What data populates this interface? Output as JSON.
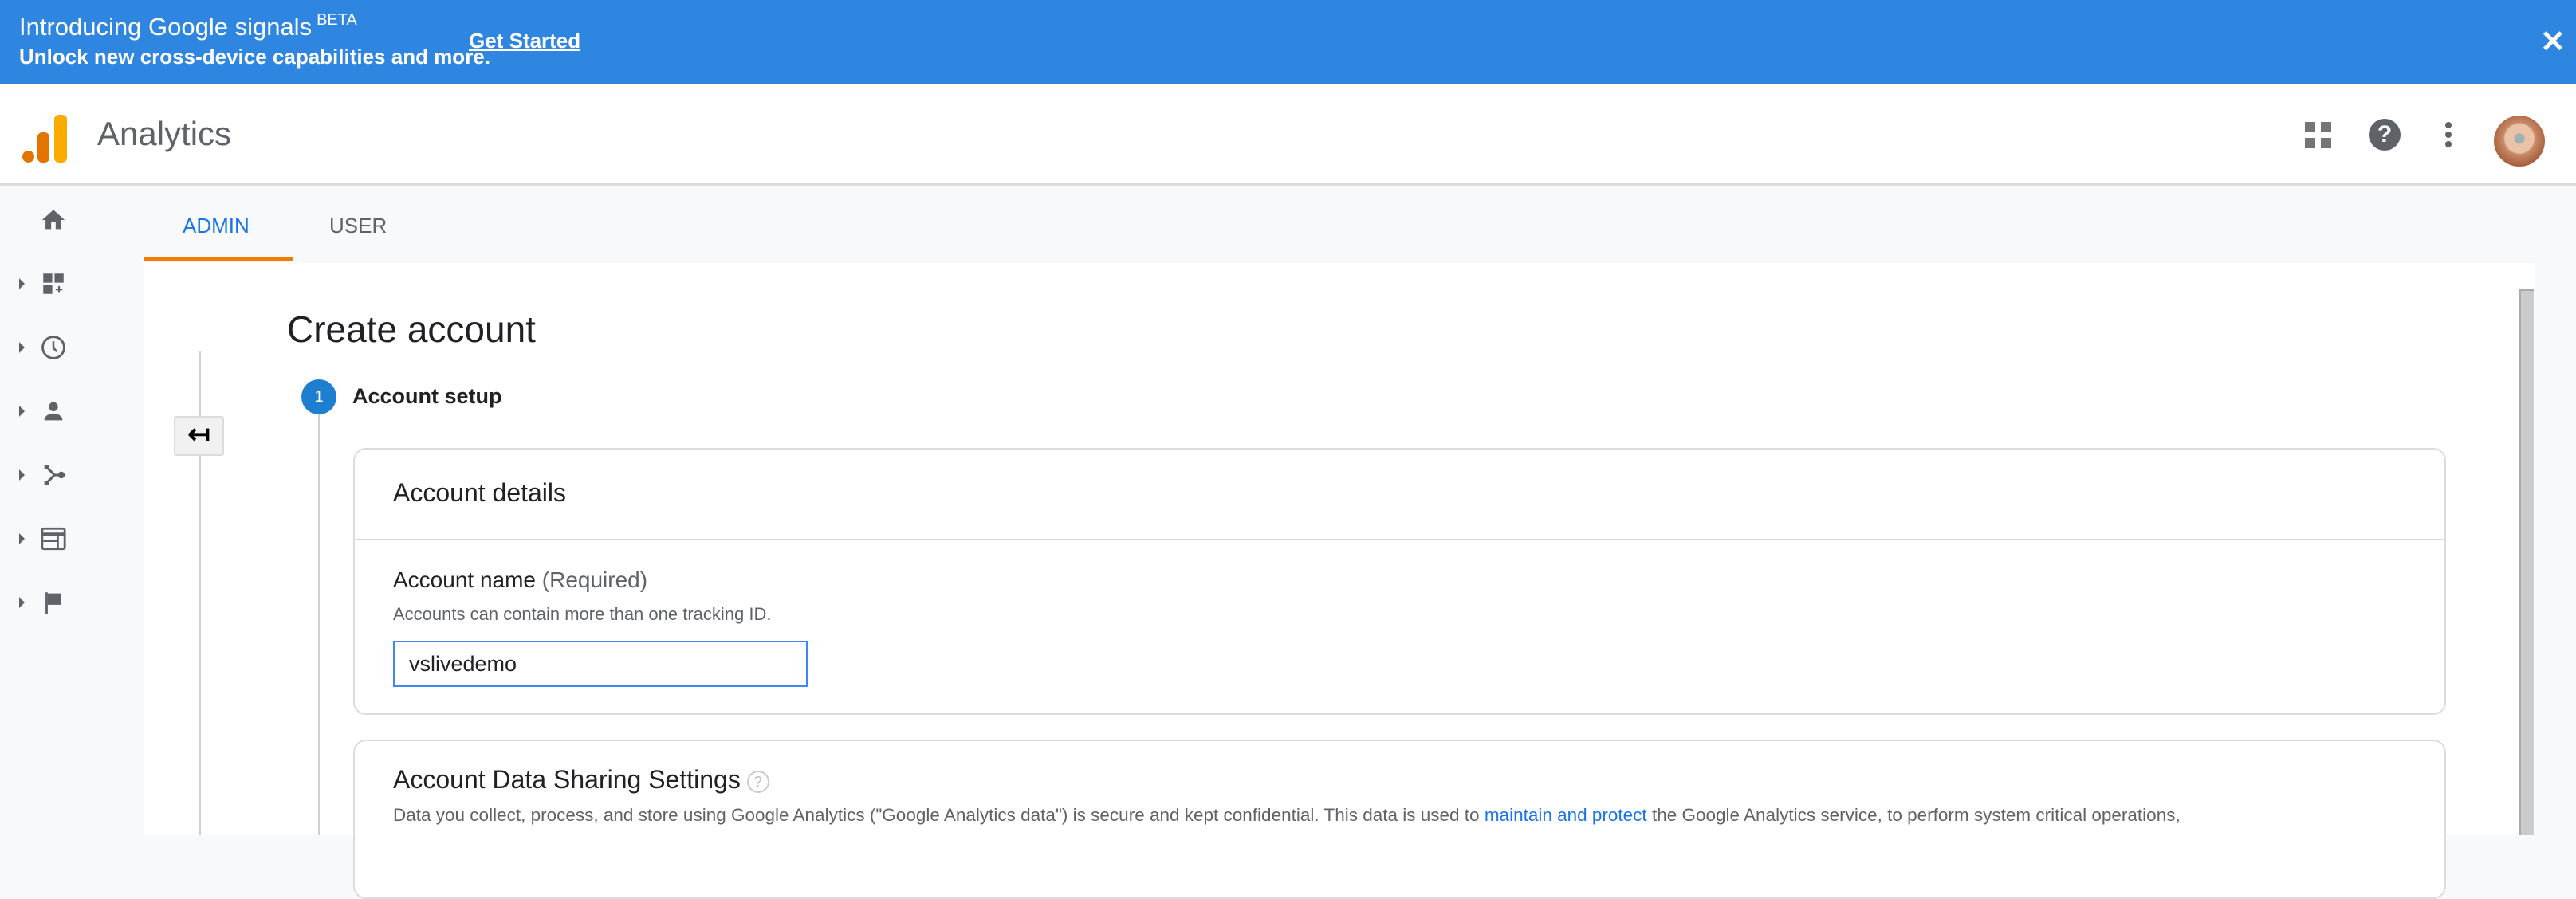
{
  "banner": {
    "title": "Introducing Google signals",
    "badge": "BETA",
    "subtitle": "Unlock new cross-device capabilities and more.",
    "cta": "Get Started",
    "close": "✕"
  },
  "header": {
    "app_name": "Analytics",
    "help": "?"
  },
  "tabs": [
    {
      "label": "ADMIN",
      "active": true
    },
    {
      "label": "USER",
      "active": false
    }
  ],
  "back_button": "↤",
  "page": {
    "title": "Create account",
    "step_number": "1",
    "step_title": "Account setup"
  },
  "account_details": {
    "title": "Account details",
    "name_label": "Account name",
    "name_required": "(Required)",
    "helper": "Accounts can contain more than one tracking ID.",
    "name_value": "vslivedemo"
  },
  "sharing": {
    "title": "Account Data Sharing Settings",
    "help": "?",
    "text_before": "Data you collect, process, and store using Google Analytics (\"Google Analytics data\") is secure and kept confidential. This data is used to ",
    "link": "maintain and protect",
    "text_after": " the Google Analytics service, to perform system critical operations,"
  },
  "colors": {
    "banner": "#2e86e0",
    "accent": "#1a73e8",
    "tab_underline": "#f57c00",
    "logo_dark": "#e37400",
    "logo_light": "#f9ab00"
  }
}
